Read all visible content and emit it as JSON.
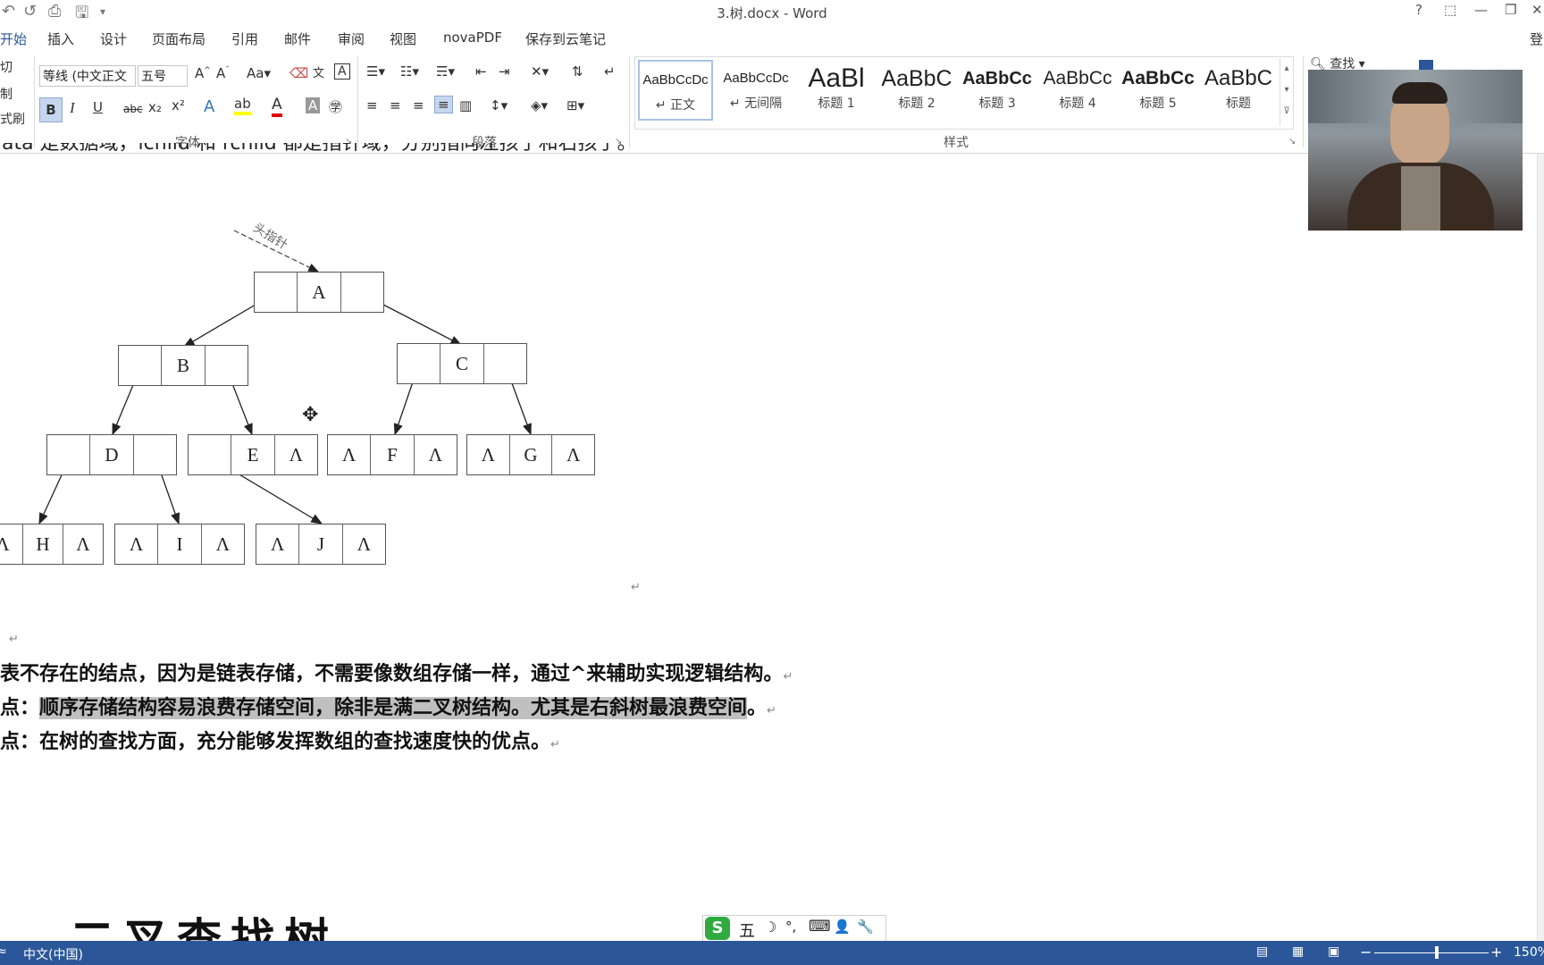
{
  "window": {
    "title": "3.树.docx - Word"
  },
  "quick_access": [
    "↺",
    "⎙",
    "🖫",
    "▾"
  ],
  "window_buttons": {
    "help": "?",
    "ribbon_display": "⬚",
    "minimize": "—",
    "restore": "❐",
    "close": "✕",
    "signin": "登"
  },
  "tabs": [
    {
      "label": "开始"
    },
    {
      "label": "插入"
    },
    {
      "label": "设计"
    },
    {
      "label": "页面布局"
    },
    {
      "label": "引用"
    },
    {
      "label": "邮件"
    },
    {
      "label": "审阅"
    },
    {
      "label": "视图"
    },
    {
      "label": "novaPDF"
    },
    {
      "label": "保存到云笔记"
    }
  ],
  "clipboard": {
    "cut": "切",
    "copy": "制",
    "format_painter": "式刷"
  },
  "font": {
    "name": "等线 (中文正文",
    "size": "五号",
    "group_label": "字体",
    "bold": "B",
    "italic": "I",
    "underline": "U",
    "strike": "abc",
    "sub": "x₂",
    "sup": "x²"
  },
  "paragraph": {
    "group_label": "段落"
  },
  "styles": {
    "group_label": "样式",
    "items": [
      {
        "sample": "AaBbCcDc",
        "name": "正文"
      },
      {
        "sample": "AaBbCcDc",
        "name": "无间隔"
      },
      {
        "sample": "AaBl",
        "name": "标题 1"
      },
      {
        "sample": "AaBbC",
        "name": "标题 2"
      },
      {
        "sample": "AaBbCc",
        "name": "标题 3"
      },
      {
        "sample": "AaBbCc",
        "name": "标题 4"
      },
      {
        "sample": "AaBbCc",
        "name": "标题 5"
      },
      {
        "sample": "AaBbC",
        "name": "标题"
      }
    ]
  },
  "editing": {
    "find": "查找"
  },
  "document": {
    "top_line": "data 是数据域，lchild 和 rchild 都是指针域，分别指向左孩子和右孩子。",
    "head_pointer_label": "头指针",
    "nodes": {
      "A": [
        "",
        "A",
        ""
      ],
      "B": [
        "",
        "B",
        ""
      ],
      "C": [
        "",
        "C",
        ""
      ],
      "D": [
        "",
        "D",
        ""
      ],
      "E": [
        "",
        "E",
        "Λ"
      ],
      "F": [
        "Λ",
        "F",
        "Λ"
      ],
      "G": [
        "Λ",
        "G",
        "Λ"
      ],
      "H": [
        "Λ",
        "H",
        "Λ"
      ],
      "I": [
        "Λ",
        "I",
        "Λ"
      ],
      "J": [
        "Λ",
        "J",
        "Λ"
      ]
    },
    "para1": "代表不存在的结点，因为是链表存储，不需要像数组存储一样，通过^来辅助实现逻辑结构。",
    "para2_prefix": "缺点：",
    "para2_highlight": "顺序存储结构容易浪费存储空间，除非是满二叉树结构。尤其是右斜树最浪费空间",
    "para2_suffix": "。",
    "para3": "优点：在树的查找方面，充分能够发挥数组的查找速度快的优点。",
    "heading": "二叉查找树",
    "paragraph_mark": "↵"
  },
  "ime": {
    "logo": "S",
    "mode": "五",
    "icons": [
      "☽",
      "°,",
      "⌨",
      "👤",
      "🔧"
    ]
  },
  "statusbar": {
    "language": "中文(中国)",
    "zoom": "150%",
    "minus": "−",
    "plus": "+"
  }
}
